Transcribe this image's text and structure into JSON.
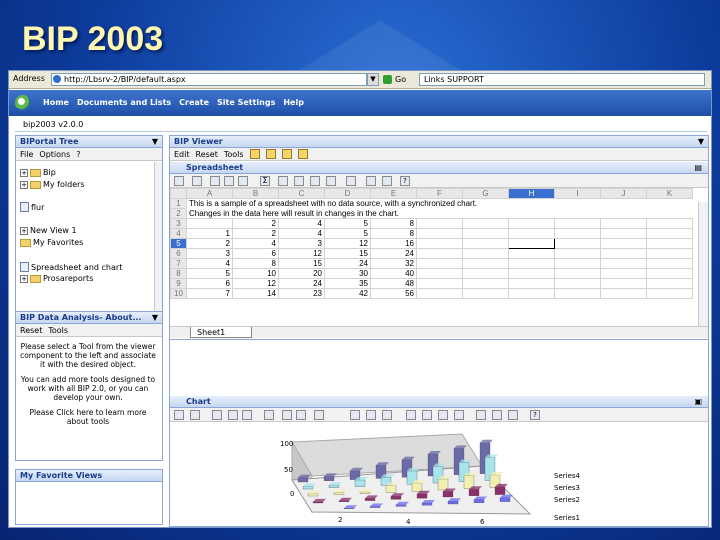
{
  "slide": {
    "title": "BIP 2003"
  },
  "browser": {
    "address_label": "Address",
    "url": "http://Lbsrv-2/BIP/default.aspx",
    "go_label": "Go",
    "links_label": "Links",
    "links_value": "SUPPORT"
  },
  "portal": {
    "nav": [
      "Home",
      "Documents and Lists",
      "Create",
      "Site Settings",
      "Help"
    ],
    "breadcrumb": "bip2003 v2.0.0"
  },
  "tree": {
    "title": "BIPortal Tree",
    "toolbar": [
      "File",
      "Options"
    ],
    "items": [
      {
        "label": "Bip",
        "type": "folder"
      },
      {
        "label": "My folders",
        "type": "folder"
      },
      {
        "label": "flur",
        "type": "doc"
      },
      {
        "label": "New View 1",
        "type": "doc"
      },
      {
        "label": "My Favorites",
        "type": "folder"
      },
      {
        "label": "Spreadsheet and chart",
        "type": "doc"
      },
      {
        "label": "Prosareports",
        "type": "folder"
      }
    ]
  },
  "analysis": {
    "title": "BIP Data Analysis- About...",
    "toolbar": [
      "Reset",
      "Tools"
    ],
    "text1": "Please select a Tool from the viewer component to the left and associate it with the desired object.",
    "text2": "You can add more tools designed to work with all BIP 2.0, or you can develop your own.",
    "text3": "Please Click here to learn more about tools"
  },
  "favorites": {
    "title": "My Favorite Views"
  },
  "viewer": {
    "title": "BIP Viewer",
    "toolbar": [
      "Edit",
      "Reset",
      "Tools"
    ]
  },
  "spreadsheet": {
    "title": "Spreadsheet",
    "columns": [
      "A",
      "B",
      "C",
      "D",
      "E",
      "F",
      "G",
      "H",
      "I",
      "J",
      "K"
    ],
    "selected_column": "H",
    "selected_row": 5,
    "row1": "This is a sample of a spreadsheet with no data source, with a synchronized chart.",
    "row2": "Changes in the data here will result in changes in the chart.",
    "data": [
      [
        3,
        "",
        2,
        4,
        5,
        8
      ],
      [
        4,
        1,
        2,
        4,
        5,
        8
      ],
      [
        5,
        2,
        4,
        3,
        12,
        16
      ],
      [
        6,
        3,
        6,
        12,
        15,
        24
      ],
      [
        7,
        4,
        8,
        15,
        24,
        32
      ],
      [
        8,
        5,
        10,
        20,
        30,
        40
      ],
      [
        9,
        6,
        12,
        24,
        35,
        48
      ],
      [
        10,
        7,
        14,
        23,
        42,
        56
      ]
    ],
    "tab": "Sheet1"
  },
  "chart": {
    "title": "Chart",
    "legend": [
      "Series4",
      "Series3",
      "Series2",
      "Series1"
    ],
    "yticks": [
      "100",
      "50",
      "0"
    ],
    "xticks": [
      "2",
      "4",
      "6"
    ]
  },
  "colors": {
    "selection": "#3a6fcf",
    "title": "#fff7b0"
  }
}
